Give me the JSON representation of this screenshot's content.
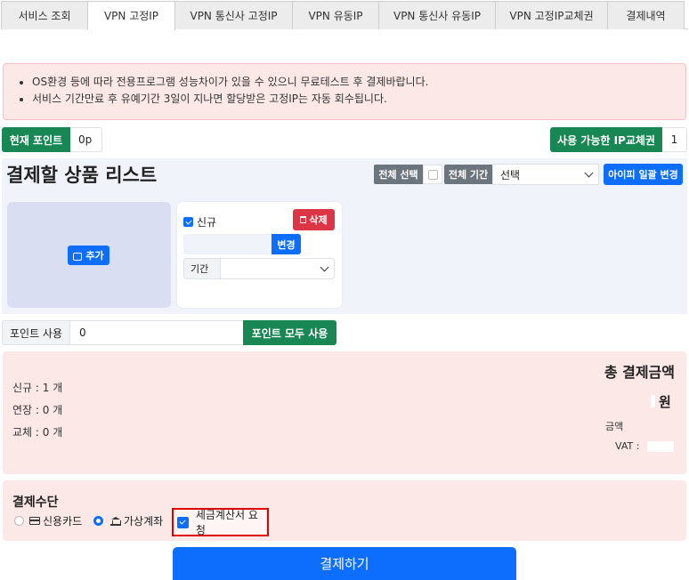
{
  "tabs": [
    {
      "label": "서비스 조회",
      "active": false
    },
    {
      "label": "VPN 고정IP",
      "active": true
    },
    {
      "label": "VPN 통신사 고정IP",
      "active": false
    },
    {
      "label": "VPN 유동IP",
      "active": false
    },
    {
      "label": "VPN 통신사 유동IP",
      "active": false
    },
    {
      "label": "VPN 고정IP교체권",
      "active": false
    },
    {
      "label": "결제내역",
      "active": false
    }
  ],
  "notice": [
    "OS환경 등에 따라 전용프로그램 성능차이가 있을 수 있으니 무료테스트 후 결제바랍니다.",
    "서비스 기간만료 후 유예기간 3일이 지나면 할당받은 고정IP는 자동 회수됩니다."
  ],
  "points": {
    "label": "현재 포인트",
    "value": "0p"
  },
  "ip_change": {
    "label": "사용 가능한 IP교체권",
    "value": "1"
  },
  "product_list": {
    "title": "결제할 상품 리스트",
    "select_all_label": "전체 선택",
    "period_label": "전체 기간",
    "period_value": "선택",
    "bulk_change_label": "아이피 일괄 변경",
    "add_label": "추가"
  },
  "item": {
    "new_label": "신규",
    "delete_label": "삭제",
    "change_label": "변경",
    "duration_label": "기간"
  },
  "point_use": {
    "label": "포인트 사용",
    "value": "0",
    "use_all_label": "포인트 모두 사용"
  },
  "summary": {
    "new_count": "신규 : 1 개",
    "extend_count": "연장 : 0 개",
    "replace_count": "교체 : 0 개",
    "total_title": "총 결제금액",
    "won": "원",
    "amount_label": "금액",
    "vat_label": "VAT :"
  },
  "payment": {
    "title": "결제수단",
    "card_label": "신용카드",
    "bank_label": "가상계좌",
    "tax_label": "세금계산서 요청",
    "submit_label": "결제하기"
  },
  "colors": {
    "primary": "#0d6efd",
    "success": "#198754",
    "danger": "#dc3545",
    "highlight": "#e00000"
  }
}
